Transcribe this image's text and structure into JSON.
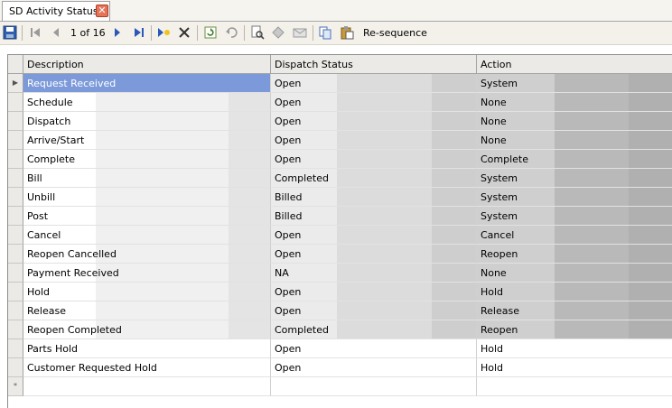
{
  "tab": {
    "title": "SD Activity Status",
    "close_glyph": "✕"
  },
  "toolbar": {
    "pager_text": "1 of 16",
    "resequence_label": "Re-sequence"
  },
  "grid": {
    "columns": [
      "Description",
      "Dispatch Status",
      "Action"
    ],
    "current_row_index": 0,
    "new_row_glyph": "*",
    "rows": [
      {
        "description": "Request Received",
        "dispatch_status": "Open",
        "action": "System"
      },
      {
        "description": "Schedule",
        "dispatch_status": "Open",
        "action": "None"
      },
      {
        "description": "Dispatch",
        "dispatch_status": "Open",
        "action": "None"
      },
      {
        "description": "Arrive/Start",
        "dispatch_status": "Open",
        "action": "None"
      },
      {
        "description": "Complete",
        "dispatch_status": "Open",
        "action": "Complete"
      },
      {
        "description": "Bill",
        "dispatch_status": "Completed",
        "action": "System"
      },
      {
        "description": "Unbill",
        "dispatch_status": "Billed",
        "action": "System"
      },
      {
        "description": "Post",
        "dispatch_status": "Billed",
        "action": "System"
      },
      {
        "description": "Cancel",
        "dispatch_status": "Open",
        "action": "Cancel"
      },
      {
        "description": "Reopen Cancelled",
        "dispatch_status": "Open",
        "action": "Reopen"
      },
      {
        "description": "Payment Received",
        "dispatch_status": "NA",
        "action": "None"
      },
      {
        "description": "Hold",
        "dispatch_status": "Open",
        "action": "Hold"
      },
      {
        "description": "Release",
        "dispatch_status": "Open",
        "action": "Release"
      },
      {
        "description": "Reopen Completed",
        "dispatch_status": "Completed",
        "action": "Reopen"
      },
      {
        "description": "Parts Hold",
        "dispatch_status": "Open",
        "action": "Hold"
      },
      {
        "description": "Customer Requested Hold",
        "dispatch_status": "Open",
        "action": "Hold"
      }
    ]
  }
}
